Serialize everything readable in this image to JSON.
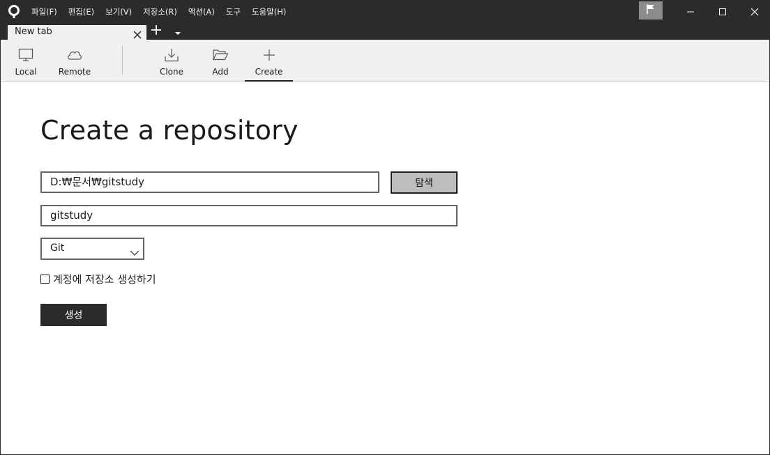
{
  "menu": [
    "파일(F)",
    "편집(E)",
    "보기(V)",
    "저장소(R)",
    "액션(A)",
    "도구",
    "도움말(H)"
  ],
  "tab": {
    "label": "New tab"
  },
  "toolbar": {
    "local": "Local",
    "remote": "Remote",
    "clone": "Clone",
    "add": "Add",
    "create": "Create"
  },
  "main": {
    "title": "Create a repository",
    "path_value": "D:₩문서₩gitstudy",
    "browse_label": "탐색",
    "name_value": "gitstudy",
    "vcs_selected": "Git",
    "account_checkbox_label": "계정에 저장소 생성하기",
    "account_checkbox_checked": false,
    "create_button_label": "생성"
  },
  "colors": {
    "titlebar": "#2b2b2b",
    "toolbar": "#f0f0f0",
    "primary_button": "#2b2b2b",
    "browse_button": "#bdbdbd"
  },
  "icons": {
    "app": "sourcetree-logo-icon",
    "flag": "flag-icon",
    "local": "monitor-icon",
    "remote": "cloud-icon",
    "clone": "download-icon",
    "add": "folder-open-icon",
    "create": "plus-icon"
  }
}
